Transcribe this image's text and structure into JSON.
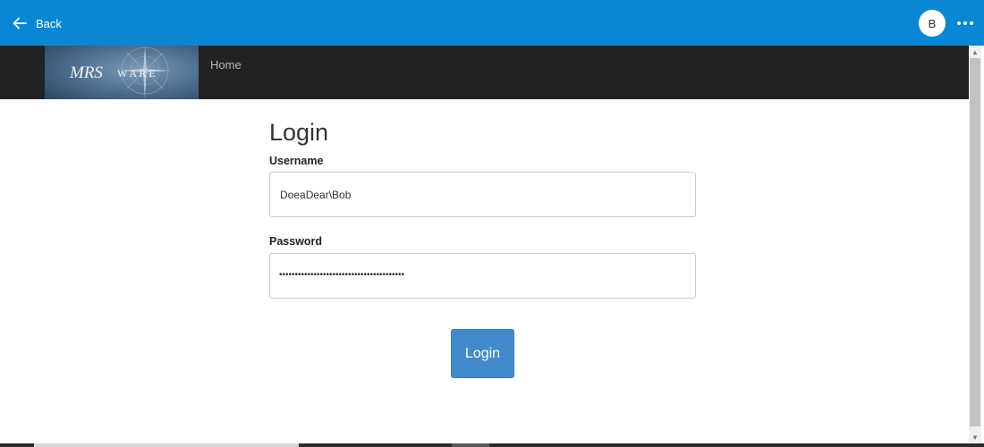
{
  "topbar": {
    "back_label": "Back",
    "avatar_initial": "B",
    "accent_color": "#0a87d4"
  },
  "navbar": {
    "logo_text_main": "MRS",
    "logo_text_rest": "W A R E",
    "home_link": "Home"
  },
  "form": {
    "title": "Login",
    "username_label": "Username",
    "username_value": "DoeaDear\\Bob",
    "password_label": "Password",
    "password_masked": "••••••••••••••••••••••••••••••••••••••••",
    "submit_label": "Login",
    "button_color": "#428bca"
  },
  "icons": {
    "back": "arrow-left-icon",
    "more": "more-horizontal-icon"
  }
}
